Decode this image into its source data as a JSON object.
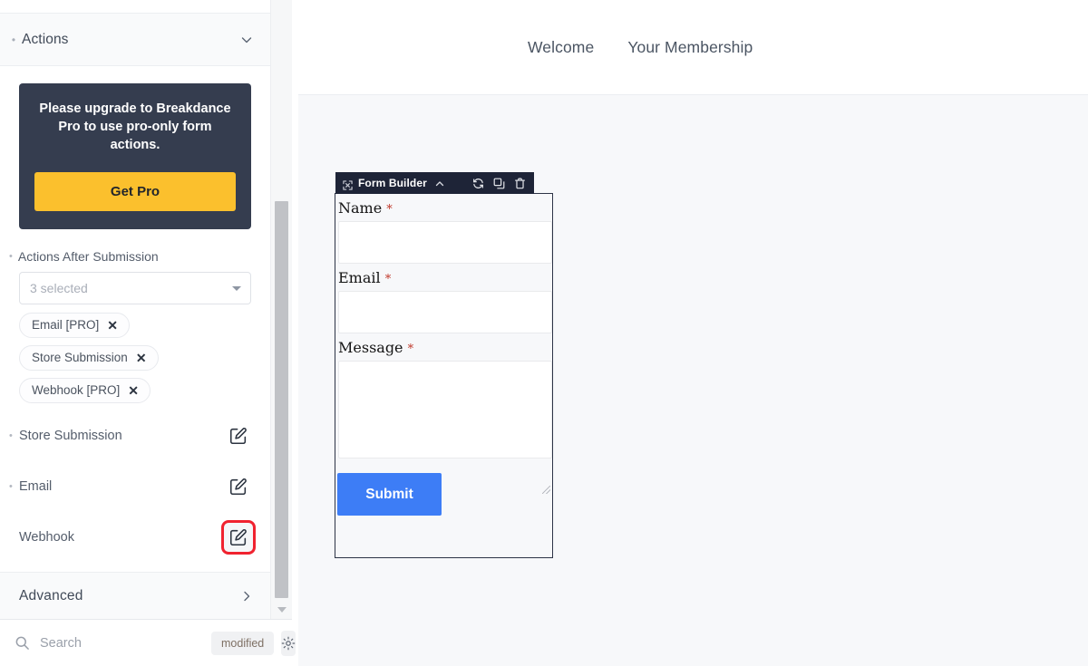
{
  "sidebar": {
    "section": {
      "title": "Actions",
      "chevron_icon": "chevron-down-icon"
    },
    "pro_card": {
      "message": "Please upgrade to Breakdance Pro to use pro-only form actions.",
      "button_label": "Get Pro",
      "bg_color": "#353d4f",
      "button_color": "#fbc02d"
    },
    "actions_after_submission": {
      "label": "Actions After Submission",
      "select_value": "3 selected",
      "chips": [
        {
          "label": "Email [PRO]",
          "remove_icon": "close-icon"
        },
        {
          "label": "Store Submission",
          "remove_icon": "close-icon"
        },
        {
          "label": "Webhook [PRO]",
          "remove_icon": "close-icon"
        }
      ]
    },
    "action_rows": [
      {
        "label": "Store Submission",
        "has_bullet": true,
        "highlighted": false,
        "edit_icon": "edit-square-icon"
      },
      {
        "label": "Email",
        "has_bullet": true,
        "highlighted": false,
        "edit_icon": "edit-square-icon"
      },
      {
        "label": "Webhook",
        "has_bullet": false,
        "highlighted": true,
        "edit_icon": "edit-square-icon"
      }
    ],
    "advanced": {
      "label": "Advanced",
      "chevron_icon": "chevron-right-icon"
    },
    "footer": {
      "search_placeholder": "Search",
      "search_value": "",
      "search_icon": "search-icon",
      "badge": "modified",
      "gear_icon": "gear-icon"
    },
    "highlight_color": "#f0222f"
  },
  "canvas": {
    "site_nav": [
      {
        "label": "Welcome"
      },
      {
        "label": "Your Membership"
      }
    ],
    "form_builder": {
      "toolbar": {
        "move_icon": "move-icon",
        "title": "Form Builder",
        "collapse_icon": "chevron-up-icon",
        "refresh_icon": "refresh-icon",
        "duplicate_icon": "duplicate-icon",
        "delete_icon": "trash-icon",
        "bg_color": "#1e2437"
      },
      "fields": [
        {
          "label": "Name",
          "required_mark": "*",
          "type": "text",
          "value": ""
        },
        {
          "label": "Email",
          "required_mark": "*",
          "type": "text",
          "value": ""
        },
        {
          "label": "Message",
          "required_mark": "*",
          "type": "textarea",
          "value": ""
        }
      ],
      "submit_label": "Submit",
      "submit_color": "#3d7df6"
    }
  }
}
